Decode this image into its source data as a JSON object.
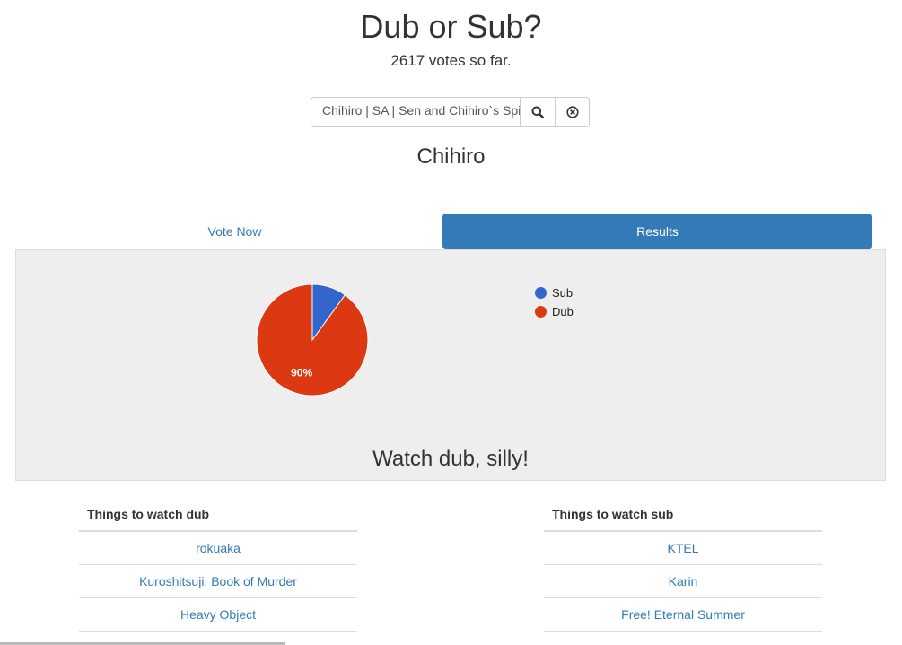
{
  "header": {
    "title": "Dub or Sub?",
    "votes_text": "2617 votes so far."
  },
  "search": {
    "value": "Chihiro | SA | Sen and Chihiro`s Spiriting Away"
  },
  "anime": {
    "name": "Chihiro"
  },
  "tabs": [
    {
      "label": "Vote Now",
      "active": false
    },
    {
      "label": "Results",
      "active": true
    }
  ],
  "chart_data": {
    "type": "pie",
    "categories": [
      "Sub",
      "Dub"
    ],
    "values": [
      10,
      90
    ],
    "colors": [
      "#3366cc",
      "#dc3912"
    ],
    "slice_labels": [
      "",
      "90%"
    ],
    "legend_position": "right"
  },
  "verdict": "Watch dub, silly!",
  "lists": {
    "dub": {
      "header": "Things to watch dub",
      "items": [
        "rokuaka",
        "Kuroshitsuji: Book of Murder",
        "Heavy Object"
      ]
    },
    "sub": {
      "header": "Things to watch sub",
      "items": [
        "KTEL",
        "Karin",
        "Free! Eternal Summer"
      ]
    }
  },
  "icons": {
    "search": "search-icon",
    "clear": "close-circle-icon"
  },
  "colors": {
    "accent": "#337ab7",
    "panel_bg": "#eeeeee"
  }
}
